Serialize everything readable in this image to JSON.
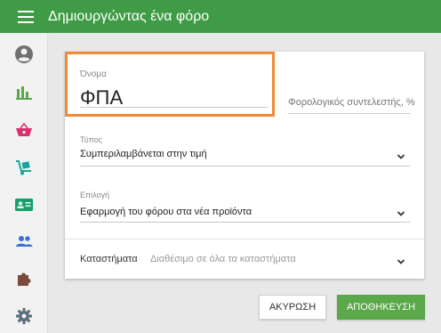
{
  "app": {
    "title": "Δημιουργώντας ένα φόρο"
  },
  "icons": {
    "menu": "menu-icon",
    "colors": {
      "account": "#707070",
      "reports": "#5aa84a",
      "basket": "#d8316e",
      "delivery": "#18a3a0",
      "card": "#15a06a",
      "people": "#3b6fd1",
      "puzzle": "#7a4a3a",
      "settings": "#5a6e7e"
    }
  },
  "form": {
    "name": {
      "label": "Όνομα",
      "value": "ΦΠΑ"
    },
    "rate": {
      "placeholder": "Φορολογικός συντελεστής, %"
    },
    "type": {
      "label": "Τύπος",
      "value": "Συμπεριλαμβάνεται στην τιμή"
    },
    "option": {
      "label": "Επιλογή",
      "value": "Εφαρμογή του φόρου στα νέα προϊόντα"
    },
    "stores": {
      "label": "Καταστήματα",
      "value": "Διαθέσιμο σε όλα τα καταστήματα"
    }
  },
  "buttons": {
    "cancel": "ΑΚΥΡΩΣΗ",
    "save": "ΑΠΟΘΗΚΕΥΣΗ"
  },
  "colors": {
    "topbar": "#3f9b45",
    "highlight": "#ee8b37",
    "save": "#5aa84a"
  }
}
